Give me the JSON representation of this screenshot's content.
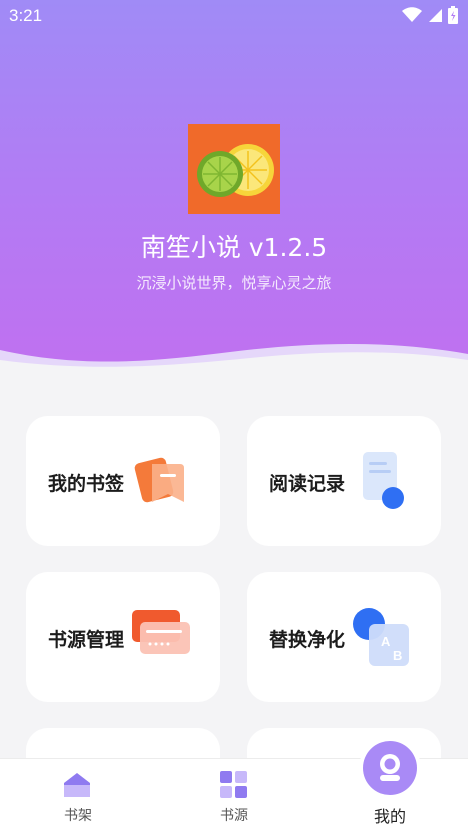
{
  "status": {
    "time": "3:21"
  },
  "app": {
    "title": "南笙小说 v1.2.5",
    "subtitle": "沉浸小说世界，悦享心灵之旅",
    "logo_icon": "lemon-lime-logo"
  },
  "cards": [
    {
      "label": "我的书签",
      "icon": "bookmark-icon"
    },
    {
      "label": "阅读记录",
      "icon": "reading-history-icon"
    },
    {
      "label": "书源管理",
      "icon": "source-cards-icon"
    },
    {
      "label": "替换净化",
      "icon": "replace-ab-icon"
    }
  ],
  "tabs": [
    {
      "label": "书架",
      "icon": "bookshelf-icon",
      "active": false
    },
    {
      "label": "书源",
      "icon": "grid-icon",
      "active": false
    },
    {
      "label": "我的",
      "icon": "profile-icon",
      "active": true
    }
  ],
  "colors": {
    "hero_top": "#a08bf6",
    "hero_bottom": "#c070f0",
    "accent": "#a98af6",
    "background": "#f4f4f6"
  }
}
